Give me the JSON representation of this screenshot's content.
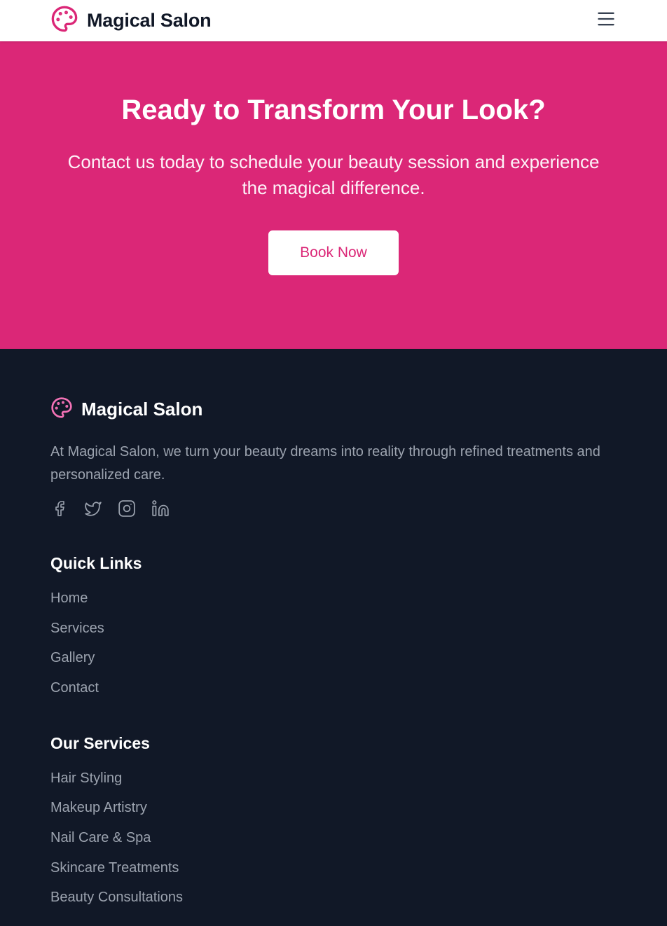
{
  "header": {
    "brand": "Magical Salon",
    "logo_icon": "palette-icon",
    "menu_icon": "hamburger-menu-icon"
  },
  "cta": {
    "title": "Ready to Transform Your Look?",
    "subtitle": "Contact us today to schedule your beauty session and experience the magical difference.",
    "button_label": "Book Now"
  },
  "footer": {
    "brand": "Magical Salon",
    "description": "At Magical Salon, we turn your beauty dreams into reality through refined treatments and personalized care.",
    "socials": [
      "facebook-icon",
      "twitter-icon",
      "instagram-icon",
      "linkedin-icon"
    ],
    "quick_links": {
      "heading": "Quick Links",
      "items": [
        "Home",
        "Services",
        "Gallery",
        "Contact"
      ]
    },
    "services": {
      "heading": "Our Services",
      "items": [
        "Hair Styling",
        "Makeup Artistry",
        "Nail Care & Spa",
        "Skincare Treatments",
        "Beauty Consultations"
      ]
    }
  },
  "colors": {
    "brand_pink": "#db2777",
    "footer_bg": "#111827",
    "text_muted": "#9ca3af"
  }
}
